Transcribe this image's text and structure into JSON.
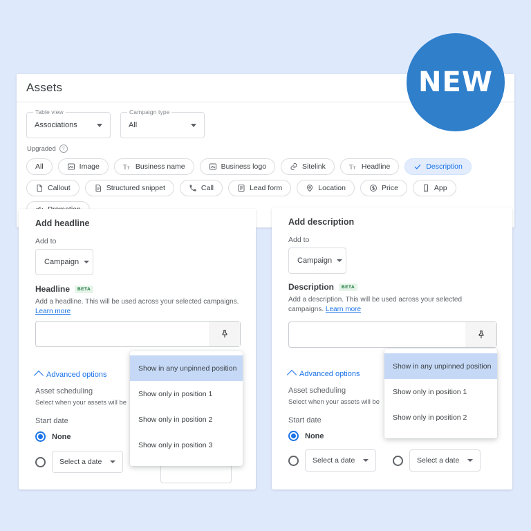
{
  "theme": {
    "page_background": "#dfe9fc",
    "accent_blue": "#1a73e8",
    "badge_blue": "#2f7fcb",
    "chip_selected_bg": "#e2ecfd",
    "dropdown_active_bg": "#c5d9f7",
    "beta_green_bg": "#e6f4ea",
    "beta_green_fg": "#137333"
  },
  "badge": {
    "label": "NEW"
  },
  "panel": {
    "title": "Assets",
    "filters": [
      {
        "legend": "Table view",
        "value": "Associations"
      },
      {
        "legend": "Campaign type",
        "value": "All"
      }
    ],
    "upgraded_label": "Upgraded",
    "help_icon": "help-circle-icon",
    "chips": [
      {
        "label": "All",
        "icon": "",
        "selected": false
      },
      {
        "label": "Image",
        "icon": "image-icon",
        "selected": false
      },
      {
        "label": "Business name",
        "icon": "text-format-icon",
        "selected": false
      },
      {
        "label": "Business logo",
        "icon": "image-icon",
        "selected": false
      },
      {
        "label": "Sitelink",
        "icon": "link-icon",
        "selected": false
      },
      {
        "label": "Headline",
        "icon": "text-format-icon",
        "selected": false
      },
      {
        "label": "Description",
        "icon": "check-icon",
        "selected": true
      },
      {
        "label": "Callout",
        "icon": "document-icon",
        "selected": false
      },
      {
        "label": "Structured snippet",
        "icon": "document-lines-icon",
        "selected": false
      },
      {
        "label": "Call",
        "icon": "phone-icon",
        "selected": false
      },
      {
        "label": "Lead form",
        "icon": "form-icon",
        "selected": false
      },
      {
        "label": "Location",
        "icon": "pin-location-icon",
        "selected": false
      },
      {
        "label": "Price",
        "icon": "dollar-circle-icon",
        "selected": false
      },
      {
        "label": "App",
        "icon": "mobile-icon",
        "selected": false
      },
      {
        "label": "Promotion",
        "icon": "megaphone-icon",
        "selected": false
      }
    ]
  },
  "headline_card": {
    "title": "Add headline",
    "add_to_label": "Add to",
    "campaign_button": "Campaign",
    "section_label": "Headline",
    "beta_tag": "BETA",
    "helper_text": "Add a headline. This will be used across your selected campaigns.",
    "learn_more": "Learn more",
    "input_value": "",
    "input_placeholder": "",
    "pin_icon": "pin-icon",
    "advanced_options": "Advanced options",
    "asset_scheduling": "Asset scheduling",
    "asset_scheduling_desc": "Select when your assets will be",
    "start_date_label": "Start date",
    "none_label": "None",
    "date_button": "Select a date",
    "pin_dropdown": {
      "items": [
        "Show in any unpinned position",
        "Show only in position 1",
        "Show only in position 2",
        "Show only in position 3"
      ],
      "active_index": 0
    }
  },
  "description_card": {
    "title": "Add description",
    "add_to_label": "Add to",
    "campaign_button": "Campaign",
    "section_label": "Description",
    "beta_tag": "BETA",
    "helper_text": "Add a description. This will be used across your selected campaigns.",
    "learn_more": "Learn more",
    "input_value": "",
    "input_placeholder": "",
    "pin_icon": "pin-icon",
    "advanced_options": "Advanced options",
    "asset_scheduling": "Asset scheduling",
    "asset_scheduling_desc": "Select when your assets will be",
    "start_date_label": "Start date",
    "none_label": "None",
    "date_button_1": "Select a date",
    "date_button_2": "Select a date",
    "pin_dropdown": {
      "items": [
        "Show in any unpinned position",
        "Show only in position 1",
        "Show only in position 2"
      ],
      "active_index": 0
    }
  }
}
